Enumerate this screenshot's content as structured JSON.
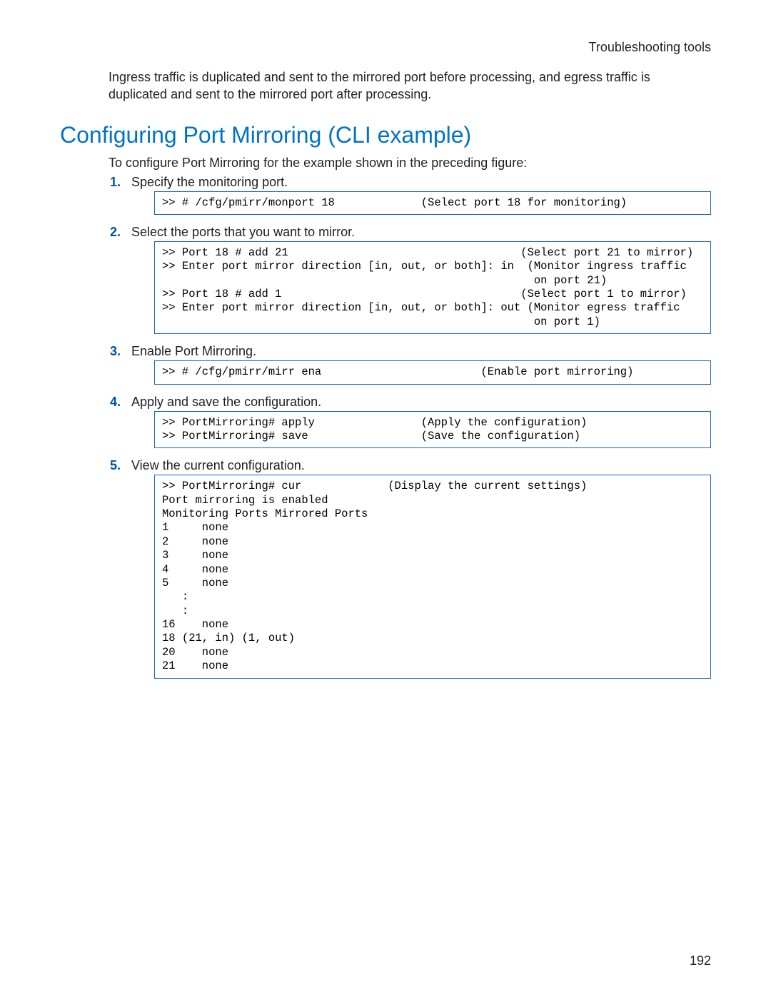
{
  "header": {
    "right": "Troubleshooting tools"
  },
  "page_number": "192",
  "intro_paragraph": "Ingress traffic is duplicated and sent to the mirrored port before processing, and egress traffic is duplicated and sent to the mirrored port after processing.",
  "section_title": "Configuring Port Mirroring (CLI example)",
  "section_intro": "To configure Port Mirroring for the example shown in the preceding figure:",
  "steps": [
    {
      "text": "Specify the monitoring port.",
      "code": ">> # /cfg/pmirr/monport 18             (Select port 18 for monitoring)"
    },
    {
      "text": "Select the ports that you want to mirror.",
      "code": ">> Port 18 # add 21                                   (Select port 21 to mirror)\n>> Enter port mirror direction [in, out, or both]: in  (Monitor ingress traffic\n                                                        on port 21)\n>> Port 18 # add 1                                    (Select port 1 to mirror)\n>> Enter port mirror direction [in, out, or both]: out (Monitor egress traffic\n                                                        on port 1)"
    },
    {
      "text": "Enable Port Mirroring.",
      "code": ">> # /cfg/pmirr/mirr ena                        (Enable port mirroring)"
    },
    {
      "text": "Apply and save the configuration.",
      "code": ">> PortMirroring# apply                (Apply the configuration)\n>> PortMirroring# save                 (Save the configuration)"
    },
    {
      "text": "View the current configuration.",
      "code": ">> PortMirroring# cur             (Display the current settings)\nPort mirroring is enabled\nMonitoring Ports Mirrored Ports\n1     none\n2     none\n3     none\n4     none\n5     none\n   :\n   :\n16    none\n18 (21, in) (1, out)\n20    none\n21    none"
    }
  ]
}
